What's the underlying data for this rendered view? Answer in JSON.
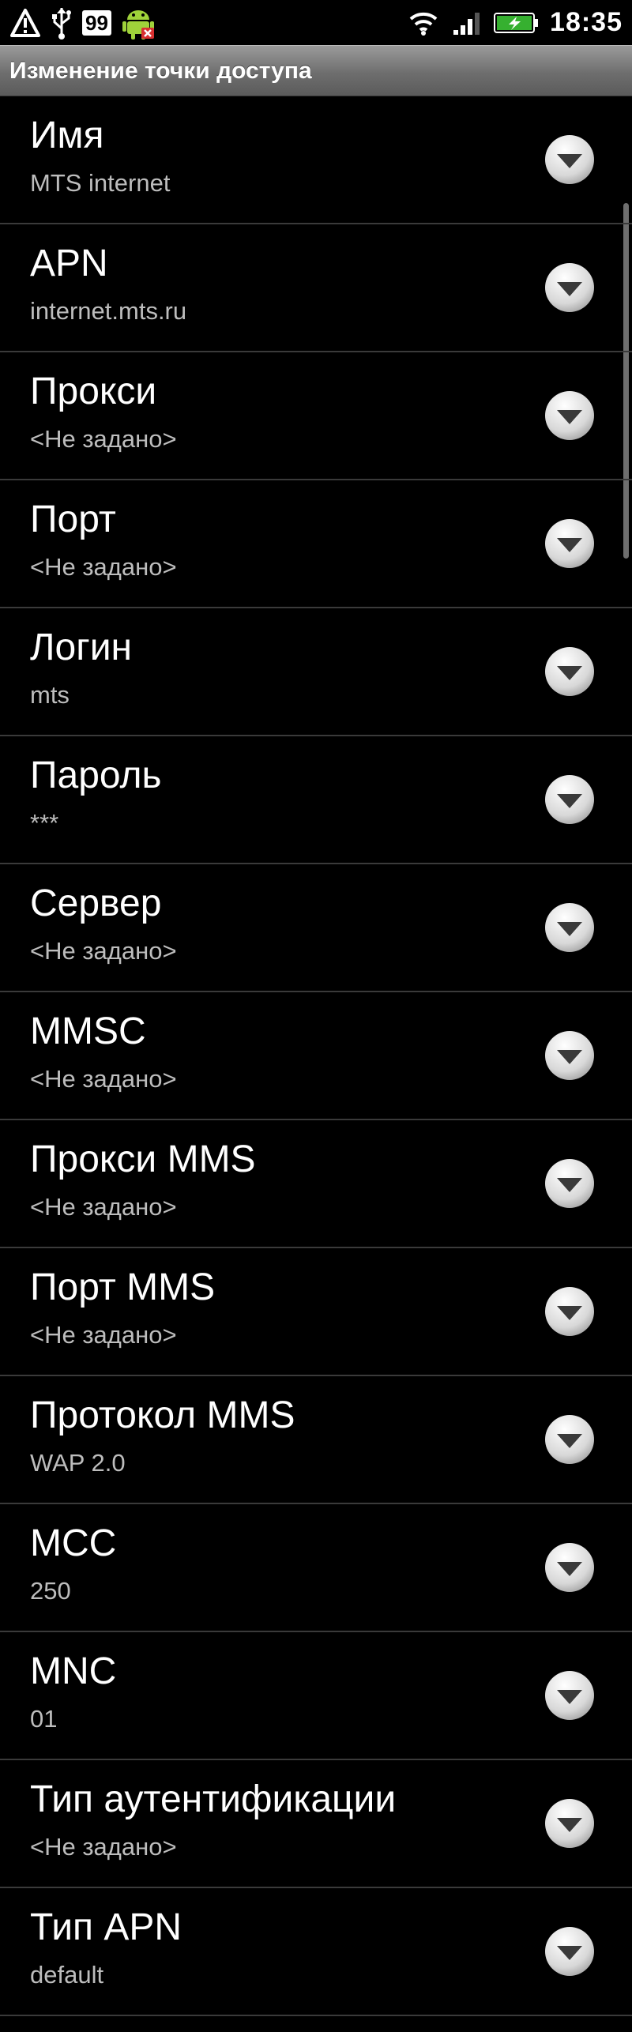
{
  "status_bar": {
    "notification_count": "99",
    "time": "18:35"
  },
  "title": "Изменение точки доступа",
  "items": [
    {
      "title": "Имя",
      "summary": "MTS internet"
    },
    {
      "title": "APN",
      "summary": "internet.mts.ru"
    },
    {
      "title": "Прокси",
      "summary": "<Не задано>"
    },
    {
      "title": "Порт",
      "summary": "<Не задано>"
    },
    {
      "title": "Логин",
      "summary": "mts"
    },
    {
      "title": "Пароль",
      "summary": "***"
    },
    {
      "title": "Сервер",
      "summary": "<Не задано>"
    },
    {
      "title": "MMSC",
      "summary": "<Не задано>"
    },
    {
      "title": "Прокси MMS",
      "summary": "<Не задано>"
    },
    {
      "title": "Порт MMS",
      "summary": "<Не задано>"
    },
    {
      "title": "Протокол MMS",
      "summary": "WAP 2.0"
    },
    {
      "title": "MCC",
      "summary": "250"
    },
    {
      "title": "MNC",
      "summary": "01"
    },
    {
      "title": "Тип аутентификации",
      "summary": "<Не задано>"
    },
    {
      "title": "Тип APN",
      "summary": "default"
    }
  ]
}
